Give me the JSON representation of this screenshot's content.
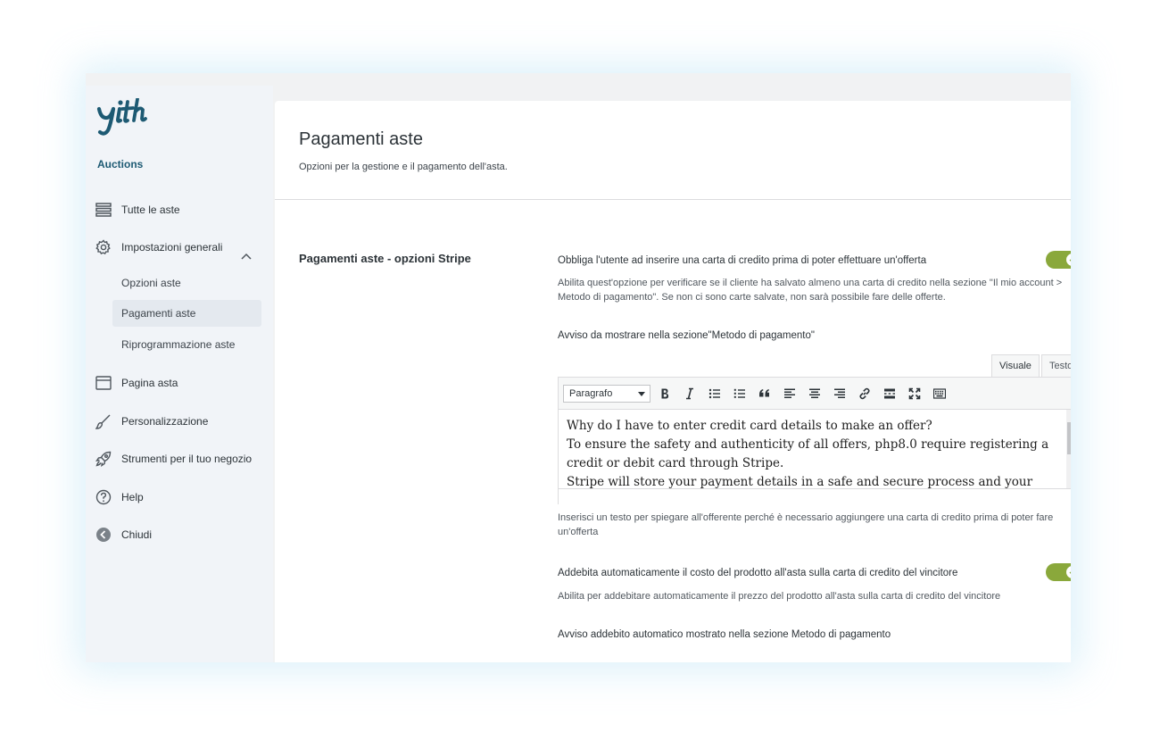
{
  "brand": {
    "name": "Auctions"
  },
  "sidebar": {
    "items": [
      {
        "label": "Tutte le aste",
        "icon": "list-icon"
      },
      {
        "label": "Impostazioni generali",
        "icon": "gear-icon"
      },
      {
        "label": "Pagina asta",
        "icon": "browser-window-icon"
      },
      {
        "label": "Personalizzazione",
        "icon": "brush-icon"
      },
      {
        "label": "Strumenti per il tuo negozio",
        "icon": "rocket-icon"
      },
      {
        "label": "Help",
        "icon": "question-icon"
      },
      {
        "label": "Chiudi",
        "icon": "back-arrow-icon"
      }
    ],
    "sub_items": [
      {
        "label": "Opzioni aste"
      },
      {
        "label": "Pagamenti aste"
      },
      {
        "label": "Riprogrammazione aste"
      }
    ],
    "active_sub": "Pagamenti aste"
  },
  "page": {
    "title": "Pagamenti aste",
    "subtitle": "Opzioni per la gestione e il pagamento dell'asta."
  },
  "section": {
    "title": "Pagamenti aste - opzioni Stripe",
    "options": [
      {
        "label": "Obbliga l'utente ad inserire una carta di credito prima di poter effettuare un'offerta",
        "description": "Abilita quest'opzione per verificare se il cliente ha salvato almeno una carta di credito nella sezione \"Il mio account > Metodo di pagamento\". Se non ci sono carte salvate, non sarà possibile fare delle offerte.",
        "enabled": true
      },
      {
        "label": "Avviso da mostrare nella sezione\"Metodo di pagamento\"",
        "description": "Inserisci un testo per spiegare all'offerente perché è necessario aggiungere una carta di credito prima di poter fare un'offerta"
      },
      {
        "label": "Addebita automaticamente il costo del prodotto all'asta sulla carta di credito del vincitore",
        "description": "Abilita per addebitare automaticamente il prezzo del prodotto all'asta sulla carta di credito del vincitore",
        "enabled": true
      },
      {
        "label": "Avviso addebito automatico mostrato nella sezione Metodo di pagamento"
      }
    ]
  },
  "editor": {
    "tabs": [
      "Visuale",
      "Testo"
    ],
    "format_select": "Paragrafo",
    "content": [
      "Why do I have to enter credit card details to make an offer?",
      "To ensure the safety and authenticity of all offers, php8.0 require registering a credit or debit card through Stripe.",
      "Stripe will store your payment details in a safe and secure process and your future"
    ]
  },
  "colors": {
    "accent": "#8aa83b",
    "brand": "#1d5a73",
    "sidebar_bg": "#f1f4f8",
    "active_bg": "#e4e9ef"
  }
}
